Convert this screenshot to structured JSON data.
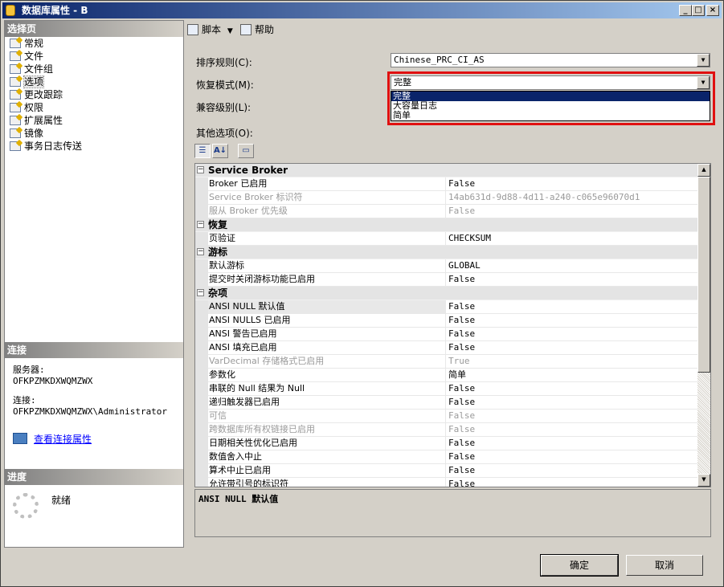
{
  "window": {
    "title": "数据库属性 - B",
    "min_label": "_",
    "max_label": "□",
    "close_label": "×"
  },
  "left": {
    "select_page_header": "选择页",
    "pages": [
      {
        "label": "常规"
      },
      {
        "label": "文件"
      },
      {
        "label": "文件组"
      },
      {
        "label": "选项",
        "selected": true
      },
      {
        "label": "更改跟踪"
      },
      {
        "label": "权限"
      },
      {
        "label": "扩展属性"
      },
      {
        "label": "镜像"
      },
      {
        "label": "事务日志传送"
      }
    ],
    "connection_header": "连接",
    "server_label": "服务器:",
    "server_value": "OFKPZMKDXWQMZWX",
    "connection_label": "连接:",
    "connection_value": "OFKPZMKDXWQMZWX\\Administrator",
    "view_connection_link": "查看连接属性",
    "progress_header": "进度",
    "progress_status": "就绪"
  },
  "toolbar": {
    "script_label": "脚本",
    "help_label": "帮助"
  },
  "form": {
    "collation_label": "排序规则(C):",
    "collation_value": "Chinese_PRC_CI_AS",
    "recovery_label": "恢复模式(M):",
    "recovery_value": "完整",
    "recovery_options": [
      "完整",
      "大容量日志",
      "简单"
    ],
    "compat_label": "兼容级别(L):",
    "other_options_label": "其他选项(O):"
  },
  "grid": {
    "rows": [
      {
        "type": "cat",
        "name": "Service Broker"
      },
      {
        "type": "prop",
        "name": "Broker 已启用",
        "value": "False"
      },
      {
        "type": "prop",
        "name": "Service Broker 标识符",
        "value": "14ab631d-9d88-4d11-a240-c065e96070d1",
        "disabled": true
      },
      {
        "type": "prop",
        "name": "服从 Broker 优先级",
        "value": "False",
        "disabled": true
      },
      {
        "type": "cat",
        "name": "恢复"
      },
      {
        "type": "prop",
        "name": "页验证",
        "value": "CHECKSUM"
      },
      {
        "type": "cat",
        "name": "游标"
      },
      {
        "type": "prop",
        "name": "默认游标",
        "value": "GLOBAL"
      },
      {
        "type": "prop",
        "name": "提交时关闭游标功能已启用",
        "value": "False"
      },
      {
        "type": "cat",
        "name": "杂项"
      },
      {
        "type": "prop",
        "name": "ANSI NULL 默认值",
        "value": "False",
        "selected": true
      },
      {
        "type": "prop",
        "name": "ANSI NULLS 已启用",
        "value": "False"
      },
      {
        "type": "prop",
        "name": "ANSI 警告已启用",
        "value": "False"
      },
      {
        "type": "prop",
        "name": "ANSI 填充已启用",
        "value": "False"
      },
      {
        "type": "prop",
        "name": "VarDecimal 存储格式已启用",
        "value": "True",
        "disabled": true
      },
      {
        "type": "prop",
        "name": "参数化",
        "value": "简单"
      },
      {
        "type": "prop",
        "name": "串联的 Null 结果为 Null",
        "value": "False"
      },
      {
        "type": "prop",
        "name": "递归触发器已启用",
        "value": "False"
      },
      {
        "type": "prop",
        "name": "可信",
        "value": "False",
        "disabled": true
      },
      {
        "type": "prop",
        "name": "跨数据库所有权链接已启用",
        "value": "False",
        "disabled": true
      },
      {
        "type": "prop",
        "name": "日期相关性优化已启用",
        "value": "False"
      },
      {
        "type": "prop",
        "name": "数值舍入中止",
        "value": "False"
      },
      {
        "type": "prop",
        "name": "算术中止已启用",
        "value": "False"
      },
      {
        "type": "prop",
        "name": "允许带引号的标识符",
        "value": "False"
      }
    ],
    "description": "ANSI NULL 默认值"
  },
  "buttons": {
    "ok_label": "确定",
    "cancel_label": "取消"
  },
  "colors": {
    "highlight": "#e01010",
    "title_bar": "#0a246a",
    "link": "#0000ff"
  }
}
